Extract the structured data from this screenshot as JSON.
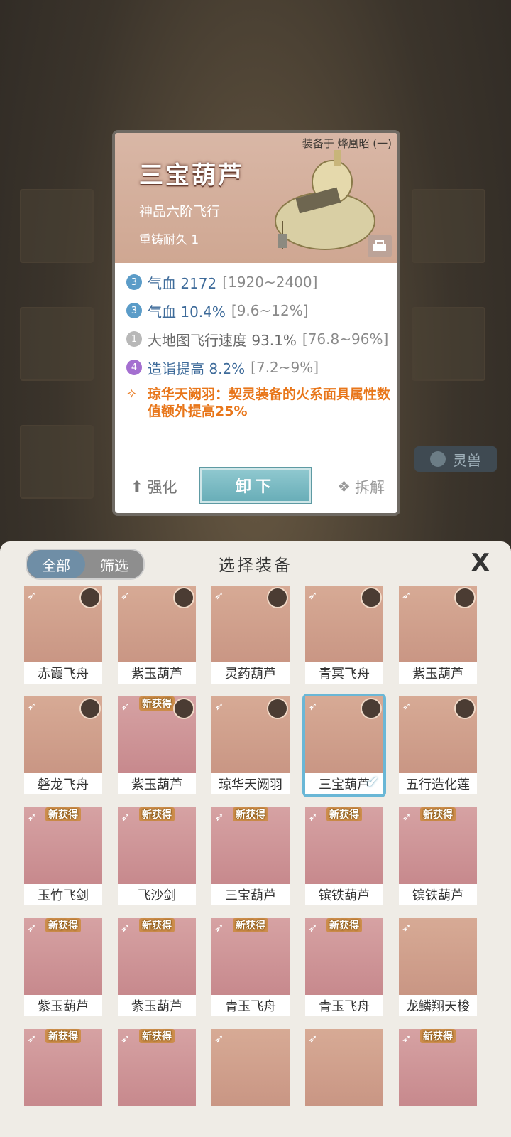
{
  "detail": {
    "equipped_label": "装备于 烨凰昭 (一)",
    "name": "三宝葫芦",
    "grade": "神品六阶飞行",
    "recast": "重铸耐久 1",
    "stats": [
      {
        "tier": "3",
        "text": "气血 2172",
        "range": "[1920~2400]"
      },
      {
        "tier": "3",
        "text": "气血 10.4%",
        "range": "[9.6~12%]"
      },
      {
        "tier": "1",
        "text": "大地图飞行速度 93.1%",
        "range": "[76.8~96%]"
      },
      {
        "tier": "4",
        "text": "造诣提高 8.2%",
        "range": "[7.2~9%]"
      }
    ],
    "special": "琼华天阙羽：契灵装备的火系面具属性数值额外提高25%",
    "buttons": {
      "strengthen": "强化",
      "unequip": "卸下",
      "dismantle": "拆解"
    }
  },
  "background": {
    "chip_label": "灵兽"
  },
  "panel": {
    "tabs": [
      "全部",
      "筛选"
    ],
    "title": "选择装备",
    "close": "X",
    "items": [
      {
        "name": "赤霞飞舟",
        "new": false
      },
      {
        "name": "紫玉葫芦",
        "new": false
      },
      {
        "name": "灵药葫芦",
        "new": false
      },
      {
        "name": "青冥飞舟",
        "new": false
      },
      {
        "name": "紫玉葫芦",
        "new": false
      },
      {
        "name": "磐龙飞舟",
        "new": false
      },
      {
        "name": "紫玉葫芦",
        "new": true
      },
      {
        "name": "琼华天阙羽",
        "new": false
      },
      {
        "name": "三宝葫芦",
        "new": false,
        "selected": true
      },
      {
        "name": "五行造化莲",
        "new": false
      },
      {
        "name": "玉竹飞剑",
        "new": true
      },
      {
        "name": "飞沙剑",
        "new": true
      },
      {
        "name": "三宝葫芦",
        "new": true
      },
      {
        "name": "镔铁葫芦",
        "new": true
      },
      {
        "name": "镔铁葫芦",
        "new": true
      },
      {
        "name": "紫玉葫芦",
        "new": true
      },
      {
        "name": "紫玉葫芦",
        "new": true
      },
      {
        "name": "青玉飞舟",
        "new": true
      },
      {
        "name": "青玉飞舟",
        "new": true
      },
      {
        "name": "龙鳞翔天梭",
        "new": false
      },
      {
        "name": "",
        "new": true
      },
      {
        "name": "",
        "new": true
      },
      {
        "name": "",
        "new": false
      },
      {
        "name": "",
        "new": false
      },
      {
        "name": "",
        "new": true
      }
    ],
    "new_tag": "新获得"
  },
  "colors": {
    "accent": "#6ab7d6",
    "special_text": "#e8761a",
    "stat_text": "#3e6b9a"
  }
}
